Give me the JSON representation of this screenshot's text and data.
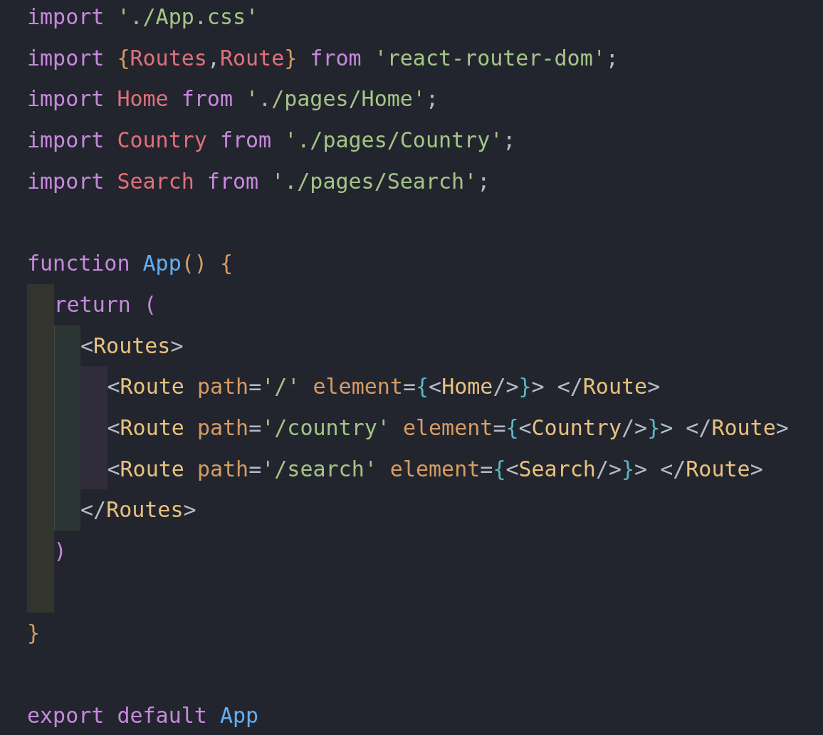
{
  "editor": {
    "lines": [
      {
        "kind": "code",
        "tokens": [
          {
            "kind": "keyword",
            "text": "import"
          },
          {
            "kind": "string",
            "text": " './App.css'"
          }
        ]
      },
      {
        "kind": "code",
        "tokens": [
          {
            "kind": "keyword",
            "text": "import"
          },
          {
            "kind": "bracket",
            "text": " {"
          },
          {
            "kind": "variable",
            "text": "Routes"
          },
          {
            "kind": "plain",
            "text": ","
          },
          {
            "kind": "variable",
            "text": "Route"
          },
          {
            "kind": "bracket",
            "text": "}"
          },
          {
            "kind": "keyword",
            "text": " from"
          },
          {
            "kind": "string",
            "text": " 'react-router-dom'"
          },
          {
            "kind": "plain",
            "text": ";"
          }
        ]
      },
      {
        "kind": "code",
        "tokens": [
          {
            "kind": "keyword",
            "text": "import"
          },
          {
            "kind": "variable",
            "text": " Home"
          },
          {
            "kind": "keyword",
            "text": " from"
          },
          {
            "kind": "string",
            "text": " './pages/Home'"
          },
          {
            "kind": "plain",
            "text": ";"
          }
        ]
      },
      {
        "kind": "code",
        "tokens": [
          {
            "kind": "keyword",
            "text": "import"
          },
          {
            "kind": "variable",
            "text": " Country"
          },
          {
            "kind": "keyword",
            "text": " from"
          },
          {
            "kind": "string",
            "text": " './pages/Country'"
          },
          {
            "kind": "plain",
            "text": ";"
          }
        ]
      },
      {
        "kind": "code",
        "tokens": [
          {
            "kind": "keyword",
            "text": "import"
          },
          {
            "kind": "variable",
            "text": " Search"
          },
          {
            "kind": "keyword",
            "text": " from"
          },
          {
            "kind": "string",
            "text": " './pages/Search'"
          },
          {
            "kind": "plain",
            "text": ";"
          }
        ]
      },
      {
        "kind": "blank"
      },
      {
        "kind": "code",
        "tokens": [
          {
            "kind": "keyword",
            "text": "function"
          },
          {
            "kind": "function",
            "text": " App"
          },
          {
            "kind": "bracket",
            "text": "() {"
          }
        ],
        "children": [
          {
            "kind": "code",
            "tokens": [
              {
                "kind": "keyword",
                "text": "return ("
              }
            ],
            "children": [
              {
                "kind": "code",
                "tokens": [
                  {
                    "kind": "plain",
                    "text": "<"
                  },
                  {
                    "kind": "tag",
                    "text": "Routes"
                  },
                  {
                    "kind": "plain",
                    "text": ">"
                  }
                ],
                "children": [
                  {
                    "kind": "code",
                    "tokens": [
                      {
                        "kind": "plain",
                        "text": "<"
                      },
                      {
                        "kind": "tag",
                        "text": "Route"
                      },
                      {
                        "kind": "attr",
                        "text": " path"
                      },
                      {
                        "kind": "plain",
                        "text": "="
                      },
                      {
                        "kind": "string",
                        "text": "'/'"
                      },
                      {
                        "kind": "attr",
                        "text": " element"
                      },
                      {
                        "kind": "plain",
                        "text": "="
                      },
                      {
                        "kind": "brace",
                        "text": "{"
                      },
                      {
                        "kind": "plain",
                        "text": "<"
                      },
                      {
                        "kind": "tag",
                        "text": "Home"
                      },
                      {
                        "kind": "plain",
                        "text": "/>"
                      },
                      {
                        "kind": "brace",
                        "text": "}"
                      },
                      {
                        "kind": "plain",
                        "text": "> </"
                      },
                      {
                        "kind": "tag",
                        "text": "Route"
                      },
                      {
                        "kind": "plain",
                        "text": ">"
                      }
                    ]
                  },
                  {
                    "kind": "code",
                    "tokens": [
                      {
                        "kind": "plain",
                        "text": "<"
                      },
                      {
                        "kind": "tag",
                        "text": "Route"
                      },
                      {
                        "kind": "attr",
                        "text": " path"
                      },
                      {
                        "kind": "plain",
                        "text": "="
                      },
                      {
                        "kind": "string",
                        "text": "'/country'"
                      },
                      {
                        "kind": "attr",
                        "text": " element"
                      },
                      {
                        "kind": "plain",
                        "text": "="
                      },
                      {
                        "kind": "brace",
                        "text": "{"
                      },
                      {
                        "kind": "plain",
                        "text": "<"
                      },
                      {
                        "kind": "tag",
                        "text": "Country"
                      },
                      {
                        "kind": "plain",
                        "text": "/>"
                      },
                      {
                        "kind": "brace",
                        "text": "}"
                      },
                      {
                        "kind": "plain",
                        "text": "> </"
                      },
                      {
                        "kind": "tag",
                        "text": "Route"
                      },
                      {
                        "kind": "plain",
                        "text": ">"
                      }
                    ]
                  },
                  {
                    "kind": "code",
                    "tokens": [
                      {
                        "kind": "plain",
                        "text": "<"
                      },
                      {
                        "kind": "tag",
                        "text": "Route"
                      },
                      {
                        "kind": "attr",
                        "text": " path"
                      },
                      {
                        "kind": "plain",
                        "text": "="
                      },
                      {
                        "kind": "string",
                        "text": "'/search'"
                      },
                      {
                        "kind": "attr",
                        "text": " element"
                      },
                      {
                        "kind": "plain",
                        "text": "="
                      },
                      {
                        "kind": "brace",
                        "text": "{"
                      },
                      {
                        "kind": "plain",
                        "text": "<"
                      },
                      {
                        "kind": "tag",
                        "text": "Search"
                      },
                      {
                        "kind": "plain",
                        "text": "/>"
                      },
                      {
                        "kind": "brace",
                        "text": "}"
                      },
                      {
                        "kind": "plain",
                        "text": "> </"
                      },
                      {
                        "kind": "tag",
                        "text": "Route"
                      },
                      {
                        "kind": "plain",
                        "text": ">"
                      }
                    ]
                  }
                ]
              },
              {
                "kind": "code",
                "tokens": [
                  {
                    "kind": "plain",
                    "text": "</"
                  },
                  {
                    "kind": "tag",
                    "text": "Routes"
                  },
                  {
                    "kind": "plain",
                    "text": ">"
                  }
                ]
              }
            ]
          },
          {
            "kind": "code",
            "tokens": [
              {
                "kind": "keyword",
                "text": ")"
              }
            ]
          },
          {
            "kind": "blank"
          }
        ]
      },
      {
        "kind": "code",
        "tokens": [
          {
            "kind": "bracket",
            "text": "}"
          }
        ]
      },
      {
        "kind": "blank"
      },
      {
        "kind": "code",
        "tokens": [
          {
            "kind": "keyword",
            "text": "export default"
          },
          {
            "kind": "function",
            "text": " App"
          }
        ]
      }
    ]
  }
}
